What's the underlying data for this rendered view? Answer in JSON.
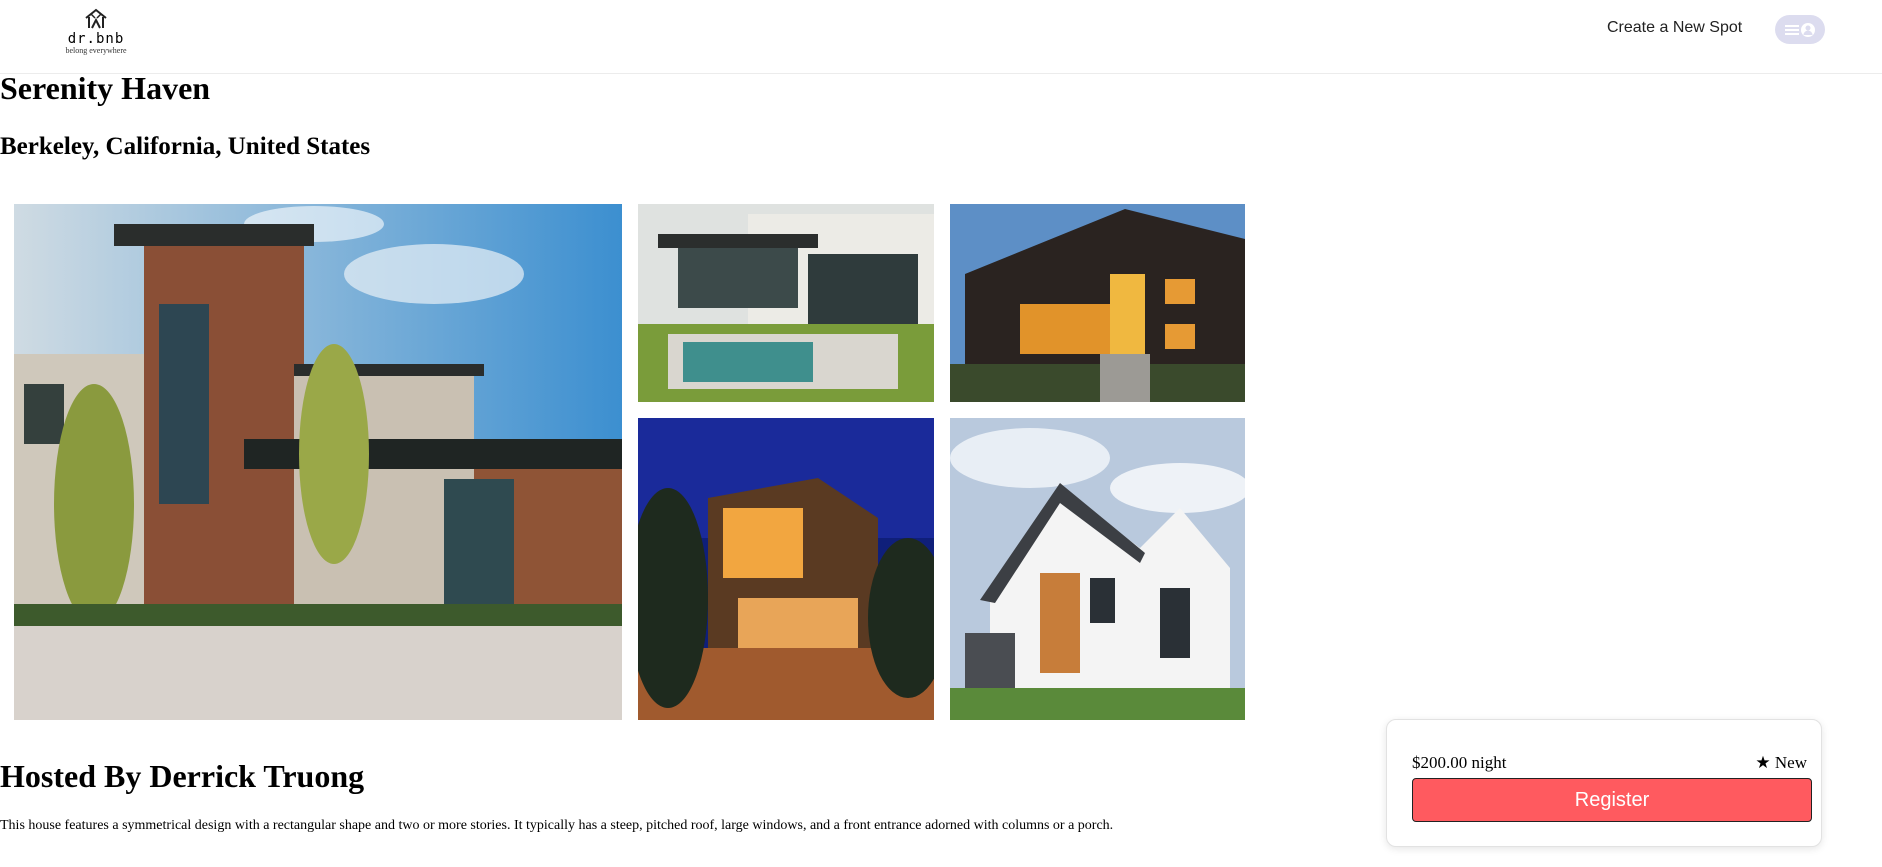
{
  "header": {
    "logo_name": "dr.bnb",
    "logo_tagline": "belong everywhere",
    "create_spot_label": "Create a New Spot",
    "profile_icon": "menu-user-icon"
  },
  "spot": {
    "name": "Serenity Haven",
    "location": "Berkeley, California, United States",
    "images": [
      {
        "alt": "Modern house with wood siding exterior"
      },
      {
        "alt": "Modern house with pool"
      },
      {
        "alt": "Modern dark house at dusk"
      },
      {
        "alt": "Modern house lit at night"
      },
      {
        "alt": "White house with gable roof"
      }
    ],
    "host_heading": "Hosted By Derrick Truong",
    "description": "This house features a symmetrical design with a rectangular shape and two or more stories. It typically has a steep, pitched roof, large windows, and a front entrance adorned with columns or a porch."
  },
  "booking": {
    "price": "$200.00 night",
    "rating": "★ New",
    "register_label": "Register"
  },
  "colors": {
    "accent": "#ff5a5f",
    "profile_bg": "#dcdcef"
  }
}
